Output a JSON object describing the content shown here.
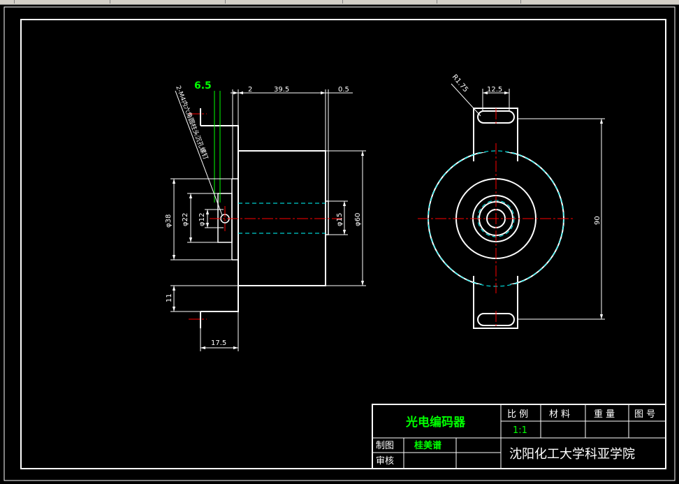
{
  "drawing": {
    "dimensions": {
      "d_6_5": "6.5",
      "d_2": "2",
      "d_39_5": "39.5",
      "d_0_5": "0.5",
      "d_38": "φ38",
      "d_22": "φ22",
      "d_12": "φ12",
      "d_15": "φ15",
      "d_60": "φ60",
      "d_11": "11",
      "d_17_5": "17.5",
      "d_12_5": "12.5",
      "d_r175": "R1.75",
      "d_90": "90"
    },
    "leader_note": "2-M4内六角圆柱头沉孔螺钉"
  },
  "title_block": {
    "part_name": "光电编码器",
    "scale_header": "比 例",
    "material_header": "材 料",
    "weight_header": "重 量",
    "drawing_no_header": "图 号",
    "scale_value": "1:1",
    "drawn_label": "制图",
    "drawn_by": "桂美谱",
    "checked_label": "审核",
    "school": "沈阳化工大学科亚学院"
  },
  "colors": {
    "background": "#000000",
    "line": "#ffffff",
    "center_line": "#ff0000",
    "hidden_line": "#00ffff",
    "highlight_text": "#00ff00"
  }
}
